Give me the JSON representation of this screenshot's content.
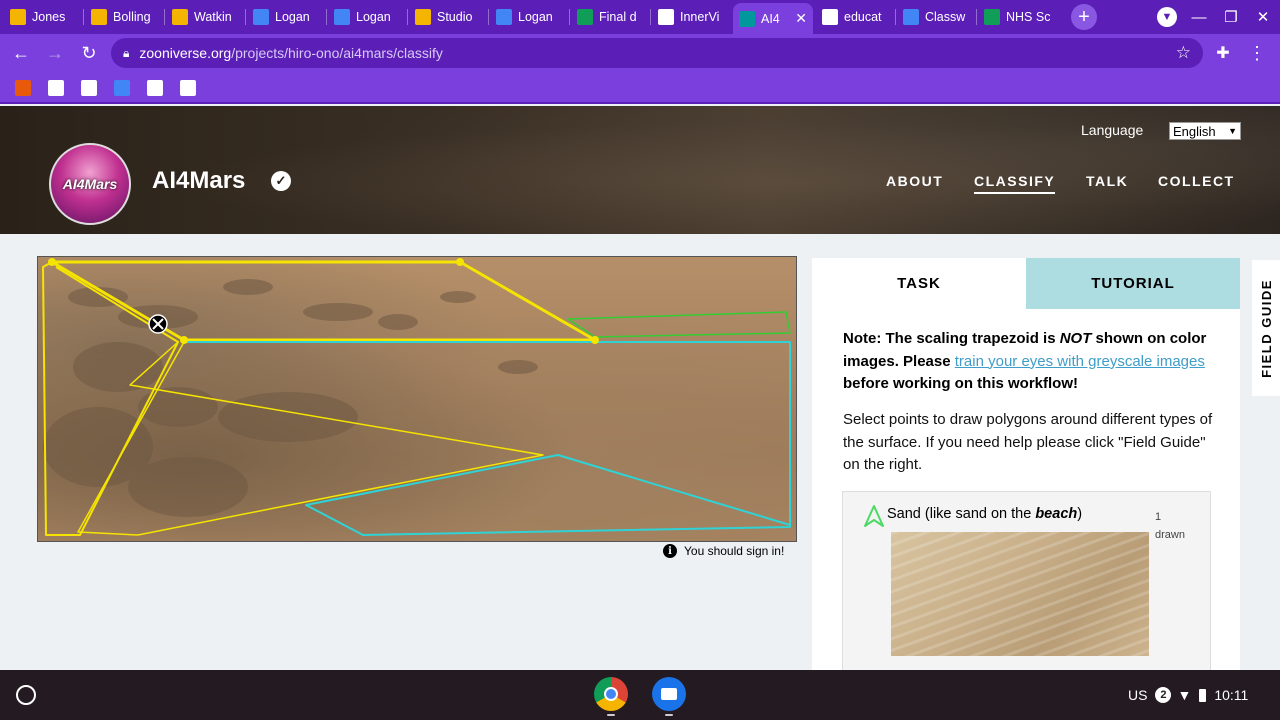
{
  "browser": {
    "tabs": [
      {
        "title": "Jones",
        "icon": "slides-icon",
        "color": "#f4b400"
      },
      {
        "title": "Bolling",
        "icon": "slides-icon",
        "color": "#f4b400"
      },
      {
        "title": "Watkin",
        "icon": "slides-icon",
        "color": "#f4b400"
      },
      {
        "title": "Logan",
        "icon": "docs-icon",
        "color": "#4285f4"
      },
      {
        "title": "Logan",
        "icon": "docs-icon",
        "color": "#4285f4"
      },
      {
        "title": "Studio",
        "icon": "slides-icon",
        "color": "#f4b400"
      },
      {
        "title": "Logan",
        "icon": "docs-icon",
        "color": "#4285f4"
      },
      {
        "title": "Final d",
        "icon": "sheets-icon",
        "color": "#0f9d58"
      },
      {
        "title": "InnerVi",
        "icon": "innerview-icon",
        "color": "#ffffff"
      },
      {
        "title": "AI4",
        "icon": "zooniverse-icon",
        "color": "#00979d",
        "active": true
      },
      {
        "title": "educat",
        "icon": "google-icon",
        "color": "#ffffff"
      },
      {
        "title": "Classw",
        "icon": "classroom-icon",
        "color": "#4285f4"
      },
      {
        "title": "NHS Sc",
        "icon": "sheets-icon",
        "color": "#0f9d58"
      }
    ],
    "url_host": "zooniverse.org",
    "url_path": "/projects/hiro-ono/ai4mars/classify",
    "bookmarks": [
      {
        "icon": "bookmark-app-icon",
        "color": "#e8590c"
      },
      {
        "icon": "photos-icon",
        "color": "#ffffff"
      },
      {
        "icon": "gmail-icon",
        "color": "#ffffff"
      },
      {
        "icon": "docs-icon",
        "color": "#4285f4"
      },
      {
        "icon": "drive-icon",
        "color": "#ffffff"
      },
      {
        "icon": "bookmark-red-icon",
        "color": "#ffffff"
      }
    ]
  },
  "header": {
    "project_title": "AI4Mars",
    "avatar_text": "AI4Mars",
    "language_label": "Language",
    "language_value": "English",
    "nav": [
      "ABOUT",
      "CLASSIFY",
      "TALK",
      "COLLECT"
    ],
    "active_nav": "CLASSIFY"
  },
  "subject": {
    "signin_text": "You should sign in!"
  },
  "task_panel": {
    "tabs": [
      "TASK",
      "TUTORIAL"
    ],
    "note_part1": "Note: The scaling trapezoid is ",
    "note_not": "NOT",
    "note_part2": " shown on color images. Please ",
    "note_link": "train your eyes with greyscale images",
    "note_part3": " before working on this workflow!",
    "description": "Select points to draw polygons around different types of the surface. If you need help please click \"Field Guide\" on the right.",
    "tool": {
      "label_prefix": "Sand (like sand on the ",
      "label_emph": "beach",
      "label_suffix": ")",
      "count": "1",
      "count_label": "drawn",
      "color": "#4cd964"
    }
  },
  "field_guide_label": "FIELD GUIDE",
  "shelf": {
    "tray_lang": "US",
    "tray_badge": "2",
    "time": "10:11"
  },
  "colors": {
    "browser_dark": "#5b1fb8",
    "browser_light": "#7a3fdc",
    "tutorial_tab": "#addde0",
    "link": "#3e9dc9",
    "polygon_yellow": "#f5e400",
    "polygon_cyan": "#2fd3d6",
    "polygon_green": "#33cc33"
  }
}
